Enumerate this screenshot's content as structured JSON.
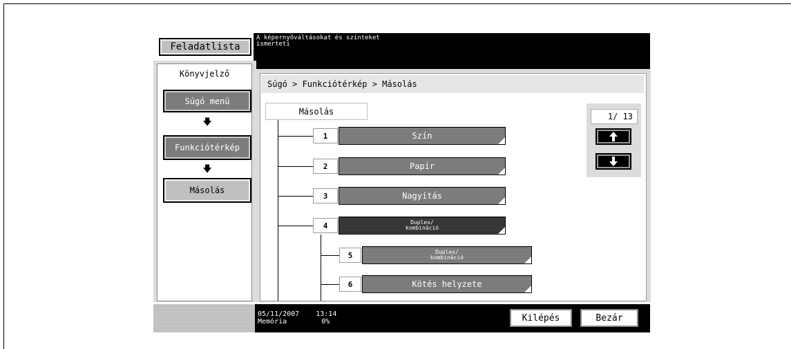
{
  "header": {
    "job_list_label": "Feladatlista",
    "message_line1": "A képernyőváltásokat és színteket",
    "message_line2": "ismerteti"
  },
  "sidebar": {
    "tab_label": "Könyvjelző",
    "items": [
      {
        "label": "Súgó menü"
      },
      {
        "label": "Funkciótérkép"
      },
      {
        "label": "Másolás"
      }
    ],
    "arrow_glyph": "🡇"
  },
  "breadcrumb": "Súgó > Funkciótérkép > Másolás",
  "tree": {
    "root_label": "Másolás",
    "items": [
      {
        "number": "1",
        "label": "Szín"
      },
      {
        "number": "2",
        "label": "Papír"
      },
      {
        "number": "3",
        "label": "Nagyítás"
      },
      {
        "number": "4",
        "label_line1": "Duplex/",
        "label_line2": "kombináció"
      },
      {
        "number": "5",
        "label_line1": "Duplex/",
        "label_line2": "kombináció"
      },
      {
        "number": "6",
        "label": "Kötés helyzete"
      }
    ]
  },
  "pager": {
    "text": "1/ 13"
  },
  "footer": {
    "date": "05/11/2007",
    "time": "13:14",
    "memory_label": "Memória",
    "memory_value": "0%",
    "exit_label": "Kilépés",
    "close_label": "Bezár"
  }
}
